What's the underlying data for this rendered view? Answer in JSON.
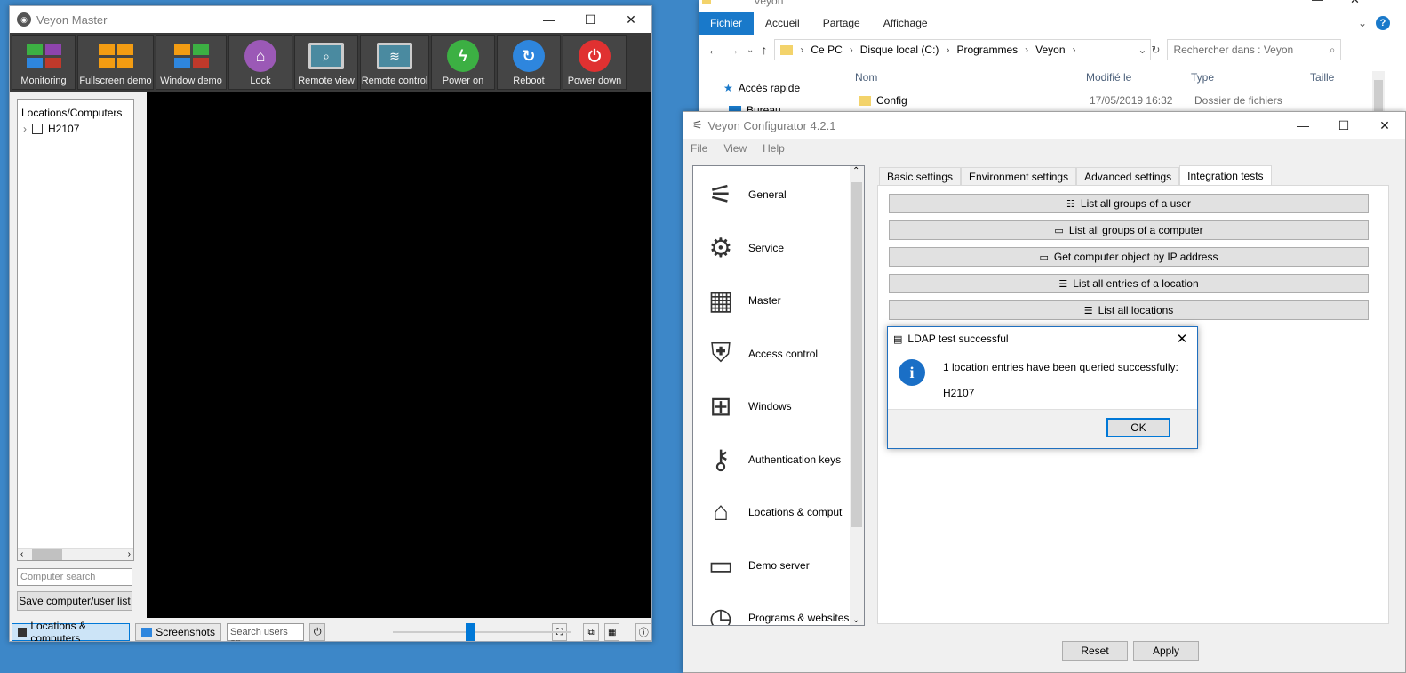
{
  "colors": {
    "desktop": "#3d87c8",
    "accent": "#0078d7",
    "toolbar_bg": "#3a3a3a"
  },
  "master": {
    "title": "Veyon Master",
    "toolbar": [
      {
        "label": "Monitoring",
        "icon": "monitoring-tiles-icon"
      },
      {
        "label": "Fullscreen demo",
        "icon": "fullscreen-demo-icon"
      },
      {
        "label": "Window demo",
        "icon": "window-demo-icon"
      },
      {
        "label": "Lock",
        "icon": "lock-icon"
      },
      {
        "label": "Remote view",
        "icon": "remote-view-icon"
      },
      {
        "label": "Remote control",
        "icon": "remote-control-icon"
      },
      {
        "label": "Power on",
        "icon": "power-on-icon"
      },
      {
        "label": "Reboot",
        "icon": "reboot-icon"
      },
      {
        "label": "Power down",
        "icon": "power-down-icon"
      }
    ],
    "locations_header": "Locations/Computers",
    "tree_item": "H2107",
    "search_placeholder": "Computer search",
    "save_button": "Save computer/user list",
    "statusbar": {
      "locations_tab": "Locations & computers",
      "screenshots_tab": "Screenshots",
      "user_search_placeholder": "Search users an..."
    }
  },
  "explorer": {
    "title": "Veyon",
    "ribbon_tabs": [
      "Fichier",
      "Accueil",
      "Partage",
      "Affichage"
    ],
    "path": [
      "Ce PC",
      "Disque local (C:)",
      "Programmes",
      "Veyon"
    ],
    "search_placeholder": "Rechercher dans : Veyon",
    "columns": [
      "Nom",
      "Modifié le",
      "Type",
      "Taille"
    ],
    "quick_access": "Accès rapide",
    "desktop_item": "Bureau",
    "row": {
      "name": "Config",
      "modified": "17/05/2019 16:32",
      "type": "Dossier de fichiers"
    }
  },
  "config": {
    "title": "Veyon Configurator 4.2.1",
    "menu": [
      "File",
      "View",
      "Help"
    ],
    "nav": [
      {
        "label": "General",
        "icon": "general-sliders-icon"
      },
      {
        "label": "Service",
        "icon": "service-gears-icon"
      },
      {
        "label": "Master",
        "icon": "master-grid-icon"
      },
      {
        "label": "Access control",
        "icon": "access-control-shield-icon"
      },
      {
        "label": "Windows",
        "icon": "windows-logo-icon"
      },
      {
        "label": "Authentication keys",
        "icon": "authentication-key-icon"
      },
      {
        "label": "Locations & comput",
        "icon": "locations-house-icon"
      },
      {
        "label": "Demo server",
        "icon": "demo-server-icon"
      },
      {
        "label": "Programs & websites",
        "icon": "programs-websites-icon"
      }
    ],
    "tabs": [
      "Basic settings",
      "Environment settings",
      "Advanced settings",
      "Integration tests"
    ],
    "test_buttons": [
      "List all groups of a user",
      "List all groups of a computer",
      "Get computer object by IP address",
      "List all entries of a location",
      "List all locations"
    ],
    "reset_button": "Reset",
    "apply_button": "Apply"
  },
  "dialog": {
    "title": "LDAP test successful",
    "message": "1 location entries have been queried successfully:",
    "detail": "H2107",
    "ok_button": "OK"
  }
}
